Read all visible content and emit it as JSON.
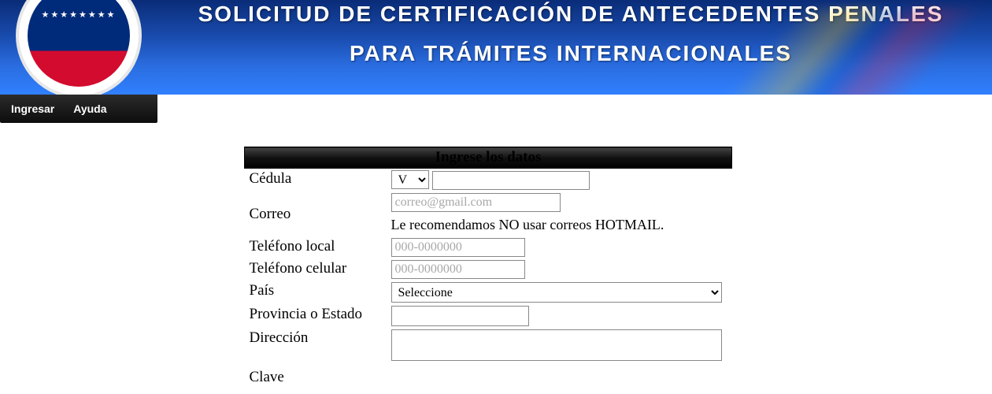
{
  "banner": {
    "line1": "SOLICITUD DE CERTIFICACIÓN DE ANTECEDENTES PENALES",
    "line2": "PARA TRÁMITES INTERNACIONALES"
  },
  "nav": {
    "ingresar": "Ingresar",
    "ayuda": "Ayuda"
  },
  "form": {
    "header": "Ingrese los datos",
    "labels": {
      "cedula": "Cédula",
      "correo": "Correo",
      "tel_local": "Teléfono local",
      "tel_celular": "Teléfono celular",
      "pais": "País",
      "provincia": "Provincia o Estado",
      "direccion": "Dirección",
      "clave": "Clave"
    },
    "cedula_tipo": "V",
    "placeholders": {
      "correo": "correo@gmail.com",
      "tel_local": "000-0000000",
      "tel_celular": "000-0000000"
    },
    "correo_note": "Le recomendamos NO usar correos HOTMAIL.",
    "pais_selected": "Seleccione"
  }
}
